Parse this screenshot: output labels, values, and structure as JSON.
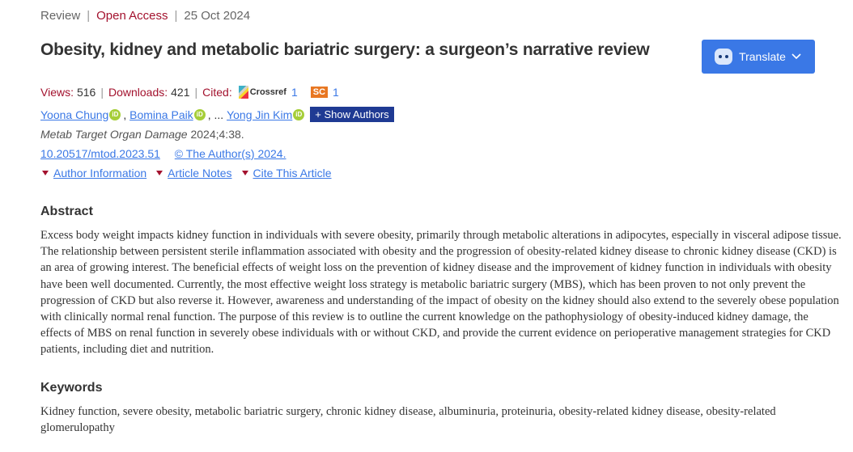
{
  "header": {
    "type": "Review",
    "access": "Open Access",
    "date": "25 Oct 2024"
  },
  "article": {
    "title": "Obesity, kidney and metabolic bariatric surgery: a surgeon’s narrative review",
    "journal_name": "Metab Target Organ Damage",
    "journal_citation": " 2024;4:38.",
    "doi": "10.20517/mtod.2023.51",
    "copyright": "© The Author(s) 2024."
  },
  "translate": {
    "label": "Translate"
  },
  "stats": {
    "views_label": "Views:",
    "views": "516",
    "downloads_label": "Downloads:",
    "downloads": "421",
    "cited_label": "Cited:",
    "crossref_label": "Crossref",
    "crossref_count": "1",
    "sc_label": "SC",
    "sc_count": "1"
  },
  "authors": {
    "list": [
      "Yoona Chung",
      "Bomina Paik",
      "Yong Jin Kim"
    ],
    "separator": ", ... ",
    "orcid_label": "iD",
    "show_label": "+ Show Authors"
  },
  "dropdowns": [
    "Author Information",
    "Article Notes",
    "Cite This Article"
  ],
  "abstract": {
    "heading": "Abstract",
    "text": "Excess body weight impacts kidney function in individuals with severe obesity, primarily through metabolic alterations in adipocytes, especially in visceral adipose tissue. The relationship between persistent sterile inflammation associated with obesity and the progression of obesity-related kidney disease to chronic kidney disease (CKD) is an area of growing interest. The beneficial effects of weight loss on the prevention of kidney disease and the improvement of kidney function in individuals with obesity have been well documented. Currently, the most effective weight loss strategy is metabolic bariatric surgery (MBS), which has been proven to not only prevent the progression of CKD but also reverse it. However, awareness and understanding of the impact of obesity on the kidney should also extend to the severely obese population with clinically normal renal function. The purpose of this review is to outline the current knowledge on the pathophysiology of obesity-induced kidney damage, the effects of MBS on renal function in severely obese individuals with or without CKD, and provide the current evidence on perioperative management strategies for CKD patients, including diet and nutrition."
  },
  "keywords": {
    "heading": "Keywords",
    "text": "Kidney function, severe obesity, metabolic bariatric surgery, chronic kidney disease, albuminuria, proteinuria, obesity-related kidney disease, obesity-related glomerulopathy"
  },
  "colors": {
    "accent": "#a3122e",
    "link": "#3a78e6",
    "button": "#3a78e6",
    "orcid": "#a6ce39"
  }
}
